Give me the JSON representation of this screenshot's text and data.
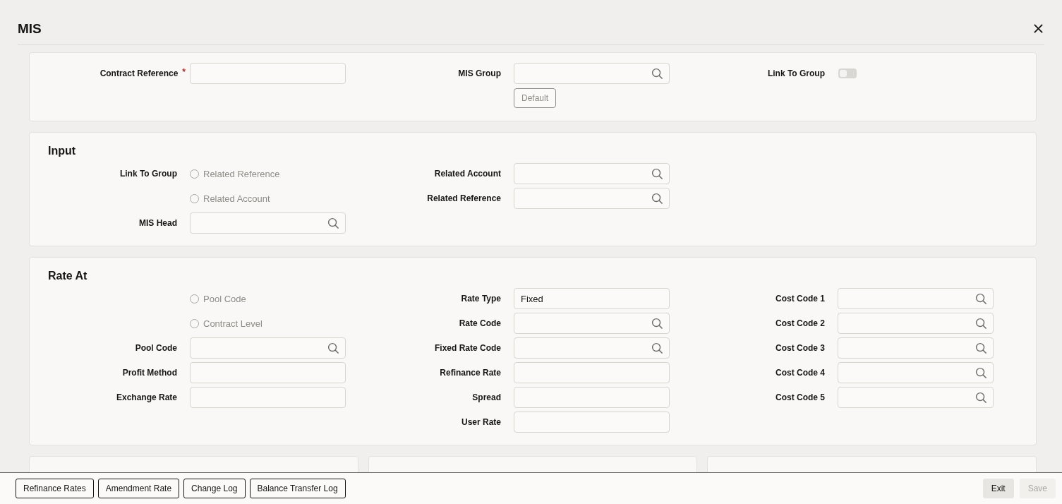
{
  "header": {
    "title": "MIS"
  },
  "sections": [
    {
      "columns": [
        [
          {
            "kind": "text",
            "label": "Contract Reference",
            "required_mark": "*"
          }
        ],
        [
          {
            "kind": "lookup",
            "label": "MIS Group"
          },
          {
            "kind": "button",
            "text": "Default",
            "disabled": true
          }
        ],
        [
          {
            "kind": "toggle",
            "label": "Link To Group",
            "on": false
          }
        ]
      ]
    },
    {
      "title": "Input",
      "columns": [
        [
          {
            "kind": "radio",
            "label": "Link To Group",
            "option": "Related Reference",
            "selected": false,
            "disabled": true
          },
          {
            "kind": "radio",
            "option": "Related Account",
            "selected": false,
            "disabled": true
          },
          {
            "kind": "lookup",
            "label": "MIS Head"
          }
        ],
        [
          {
            "kind": "lookup",
            "label": "Related Account"
          },
          {
            "kind": "lookup",
            "label": "Related Reference"
          }
        ],
        []
      ]
    },
    {
      "title": "Rate At",
      "columns": [
        [
          {
            "kind": "radio",
            "option": "Pool Code",
            "selected": false,
            "disabled": true
          },
          {
            "kind": "radio",
            "option": "Contract Level",
            "selected": false,
            "disabled": true
          },
          {
            "kind": "lookup",
            "label": "Pool Code"
          },
          {
            "kind": "text",
            "label": "Profit Method"
          },
          {
            "kind": "text",
            "label": "Exchange Rate"
          }
        ],
        [
          {
            "kind": "text",
            "label": "Rate Type",
            "value": "Fixed"
          },
          {
            "kind": "lookup",
            "label": "Rate Code"
          },
          {
            "kind": "lookup",
            "label": "Fixed Rate Code"
          },
          {
            "kind": "text",
            "label": "Refinance Rate"
          },
          {
            "kind": "text",
            "label": "Spread"
          },
          {
            "kind": "text",
            "label": "User Rate"
          }
        ],
        [
          {
            "kind": "lookup",
            "label": "Cost Code 1"
          },
          {
            "kind": "lookup",
            "label": "Cost Code 2"
          },
          {
            "kind": "lookup",
            "label": "Cost Code 3"
          },
          {
            "kind": "lookup",
            "label": "Cost Code 4"
          },
          {
            "kind": "lookup",
            "label": "Cost Code 5"
          }
        ]
      ]
    }
  ],
  "footer": {
    "left_buttons": [
      {
        "text": "Refinance Rates",
        "disabled": false
      },
      {
        "text": "Amendment Rate",
        "disabled": false
      },
      {
        "text": "Change Log",
        "disabled": false
      },
      {
        "text": "Balance Transfer Log",
        "disabled": false
      }
    ],
    "right_buttons": [
      {
        "text": "Exit",
        "disabled": false
      },
      {
        "text": "Save",
        "disabled": true
      }
    ]
  }
}
